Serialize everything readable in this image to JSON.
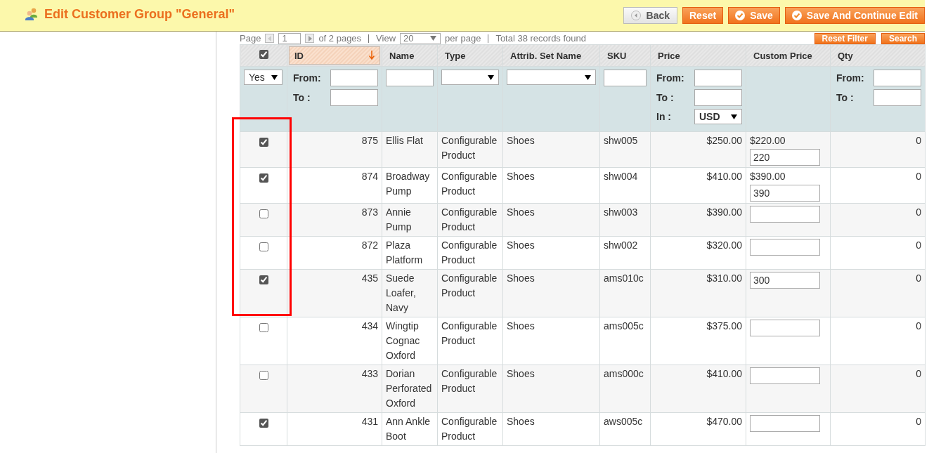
{
  "header": {
    "title": "Edit Customer Group \"General\"",
    "buttons": [
      {
        "label": "Back",
        "kind": "back"
      },
      {
        "label": "Reset",
        "kind": "plain"
      },
      {
        "label": "Save",
        "kind": "check"
      },
      {
        "label": "Save And Continue Edit",
        "kind": "check"
      }
    ]
  },
  "pager": {
    "page_label": "Page",
    "page": "1",
    "of_pages": "of 2 pages",
    "view_label": "View",
    "view": "20",
    "per_page": "per page",
    "total": "Total 38 records found",
    "buttons": [
      "Reset Filter",
      "Search"
    ]
  },
  "table": {
    "select_all_checked": true,
    "columns": [
      {
        "label": "ID",
        "sorted": true
      },
      {
        "label": "Name",
        "sorted": false
      },
      {
        "label": "Type",
        "sorted": false
      },
      {
        "label": "Attrib. Set Name",
        "sorted": false
      },
      {
        "label": "SKU",
        "sorted": false
      },
      {
        "label": "Price",
        "sorted": false
      },
      {
        "label": "Custom Price",
        "sorted": false
      },
      {
        "label": "Qty",
        "sorted": false
      }
    ],
    "filters": [
      {
        "kind": "select",
        "value": "Yes"
      },
      {
        "kind": "range",
        "from": "From:",
        "to": "To :"
      },
      {
        "kind": "text"
      },
      {
        "kind": "select"
      },
      {
        "kind": "select"
      },
      {
        "kind": "text"
      },
      {
        "kind": "currency",
        "from": "From:",
        "to": "To :",
        "in": "In :",
        "value": "USD"
      },
      {
        "kind": "none"
      },
      {
        "kind": "range",
        "from": "From:",
        "to": "To :"
      }
    ],
    "rows": [
      {
        "checked": true,
        "id": "875",
        "name": "Ellis Flat",
        "type": "Configurable Product",
        "set": "Shoes",
        "sku": "shw005",
        "price": "$250.00",
        "custom_text": "$220.00",
        "custom_value": "220",
        "qty": "0"
      },
      {
        "checked": true,
        "id": "874",
        "name": "Broadway Pump",
        "type": "Configurable Product",
        "set": "Shoes",
        "sku": "shw004",
        "price": "$410.00",
        "custom_text": "$390.00",
        "custom_value": "390",
        "qty": "0"
      },
      {
        "checked": false,
        "id": "873",
        "name": "Annie Pump",
        "type": "Configurable Product",
        "set": "Shoes",
        "sku": "shw003",
        "price": "$390.00",
        "custom_value": "",
        "qty": "0"
      },
      {
        "checked": false,
        "id": "872",
        "name": "Plaza Platform",
        "type": "Configurable Product",
        "set": "Shoes",
        "sku": "shw002",
        "price": "$320.00",
        "custom_value": "",
        "qty": "0"
      },
      {
        "checked": true,
        "id": "435",
        "name": "Suede Loafer, Navy",
        "type": "Configurable Product",
        "set": "Shoes",
        "sku": "ams010c",
        "price": "$310.00",
        "custom_value": "300",
        "qty": "0"
      },
      {
        "checked": false,
        "id": "434",
        "name": "Wingtip Cognac Oxford",
        "type": "Configurable Product",
        "set": "Shoes",
        "sku": "ams005c",
        "price": "$375.00",
        "custom_value": "",
        "qty": "0"
      },
      {
        "checked": false,
        "id": "433",
        "name": "Dorian Perforated Oxford",
        "type": "Configurable Product",
        "set": "Shoes",
        "sku": "ams000c",
        "price": "$410.00",
        "custom_value": "",
        "qty": "0"
      },
      {
        "checked": true,
        "id": "431",
        "name": "Ann Ankle Boot",
        "type": "Configurable Product",
        "set": "Shoes",
        "sku": "aws005c",
        "price": "$470.00",
        "custom_value": "",
        "qty": "0"
      }
    ]
  }
}
